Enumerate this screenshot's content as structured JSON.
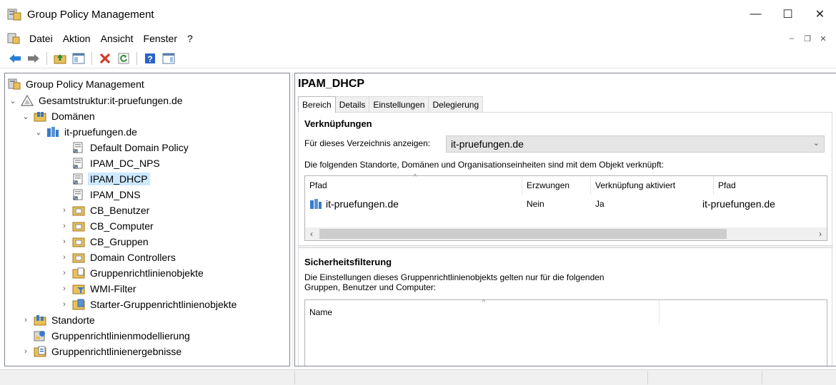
{
  "window": {
    "title": "Group Policy Management"
  },
  "menu": {
    "items": [
      "Datei",
      "Aktion",
      "Ansicht",
      "Fenster",
      "?"
    ]
  },
  "tree": {
    "root": "Group Policy Management",
    "forest": "Gesamtstruktur:it-pruefungen.de",
    "domains": "Domänen",
    "domain": "it-pruefungen.de",
    "gpo_links": [
      "Default Domain Policy",
      "IPAM_DC_NPS",
      "IPAM_DHCP",
      "IPAM_DNS"
    ],
    "ous": [
      "CB_Benutzer",
      "CB_Computer",
      "CB_Gruppen",
      "Domain Controllers"
    ],
    "containers": [
      "Gruppenrichtlinienobjekte",
      "WMI-Filter",
      "Starter-Gruppenrichtlinienobjekte"
    ],
    "sites": "Standorte",
    "modeling": "Gruppenrichtlinienmodellierung",
    "results": "Gruppenrichtlinienergebnisse",
    "selected": "IPAM_DHCP"
  },
  "details": {
    "title": "IPAM_DHCP",
    "tabs": [
      "Bereich",
      "Details",
      "Einstellungen",
      "Delegierung"
    ],
    "links": {
      "heading": "Verknüpfungen",
      "show_label": "Für dieses Verzeichnis anzeigen:",
      "show_value": "it-pruefungen.de",
      "description": "Die folgenden Standorte, Domänen und Organisationseinheiten sind mit dem Objekt verknüpft:",
      "columns": [
        "Pfad",
        "Erzwungen",
        "Verknüpfung aktiviert",
        "Pfad"
      ],
      "rows": [
        {
          "name": "it-pruefungen.de",
          "enforced": "Nein",
          "enabled": "Ja",
          "path": "it-pruefungen.de"
        }
      ]
    },
    "security": {
      "heading": "Sicherheitsfilterung",
      "description_line1": "Die Einstellungen dieses Gruppenrichtlinienobjekts gelten nur für die folgenden",
      "description_line2": "Gruppen, Benutzer und Computer:",
      "columns": [
        "Name"
      ]
    }
  }
}
